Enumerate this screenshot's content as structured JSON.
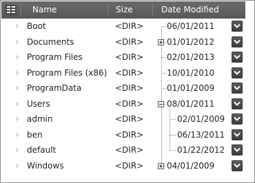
{
  "header": {
    "name_label": "Name",
    "size_label": "Size",
    "date_label": "Date Modified",
    "menu_icon": "column-chooser-icon"
  },
  "rows": [
    {
      "name": "Boot",
      "size": "<DIR>",
      "date": "06/01/2011",
      "expander": "none"
    },
    {
      "name": "Documents",
      "size": "<DIR>",
      "date": "01/01/2012",
      "expander": "collapsed"
    },
    {
      "name": "Program Files",
      "size": "<DIR>",
      "date": "02/01/2013",
      "expander": "none"
    },
    {
      "name": "Program Files (x86)",
      "size": "<DIR>",
      "date": "10/01/2010",
      "expander": "none"
    },
    {
      "name": "ProgramData",
      "size": "<DIR>",
      "date": "01/01/2009",
      "expander": "none"
    },
    {
      "name": "Users",
      "size": "<DIR>",
      "date": "08/01/2011",
      "expander": "expanded"
    },
    {
      "name": "admin",
      "size": "<DIR>",
      "date": "02/01/2009",
      "expander": "child"
    },
    {
      "name": "ben",
      "size": "<DIR>",
      "date": "06/13/2011",
      "expander": "child"
    },
    {
      "name": "default",
      "size": "<DIR>",
      "date": "01/22/2012",
      "expander": "child"
    },
    {
      "name": "Windows",
      "size": "<DIR>",
      "date": "04/01/2009",
      "expander": "collapsed"
    }
  ],
  "row_button_icon": "chevron-down-icon",
  "colors": {
    "header_bg": "#5f5f5f",
    "header_text": "#ffffff",
    "button_bg": "#4a4a4a",
    "tree_line": "#7a7a7a"
  }
}
